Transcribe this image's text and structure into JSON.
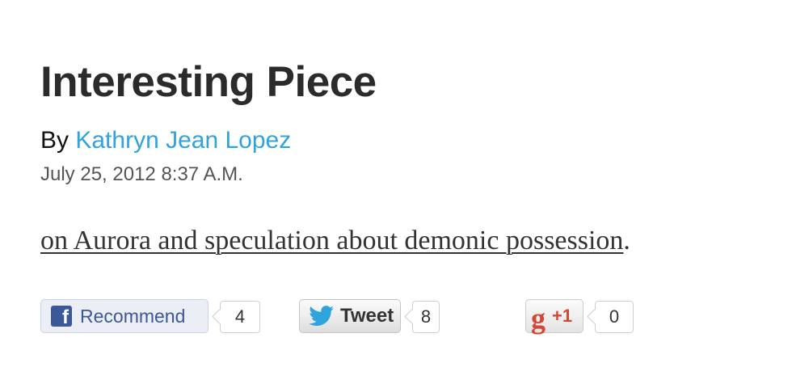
{
  "article": {
    "title": "Interesting Piece",
    "byline_prefix": "By ",
    "author": "Kathryn Jean Lopez",
    "date": "July 25, 2012 8:37 A.M.",
    "body_link_text": "on Aurora and speculation about demonic possession",
    "body_suffix": "."
  },
  "share": {
    "facebook": {
      "label": "Recommend",
      "icon": "facebook-icon",
      "icon_glyph": "f",
      "count": "4",
      "color": "#3b5998"
    },
    "twitter": {
      "label": "Tweet",
      "icon": "twitter-bird-icon",
      "count": "8",
      "color": "#2fa3dc"
    },
    "google": {
      "label": "+1",
      "icon": "google-icon",
      "icon_glyph": "g",
      "count": "0",
      "color": "#d14836"
    }
  },
  "colors": {
    "link_accent": "#2fa3dc",
    "title": "#2b2b2b"
  }
}
